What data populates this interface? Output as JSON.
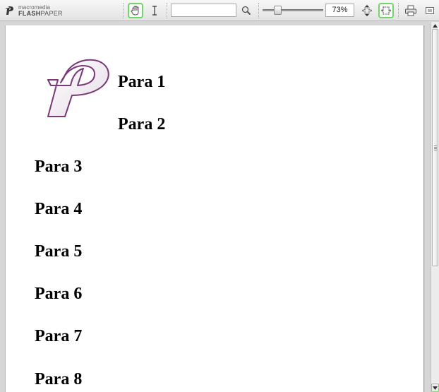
{
  "toolbar": {
    "logo_top": "macromedia",
    "logo_bold": "FLASH",
    "logo_rest": "PAPER",
    "tools": [
      "hand-tool-icon",
      "text-select-icon",
      "search-icon",
      "fit-height-icon",
      "fit-width-icon",
      "print-icon",
      "options-menu-icon"
    ],
    "search": {
      "value": "",
      "placeholder": ""
    },
    "zoom": {
      "value": "73%",
      "slider_fraction": 0.22
    },
    "active_color": "#74d36a"
  },
  "document": {
    "paragraphs": [
      "Para 1",
      "Para 2",
      "Para 3",
      "Para 4",
      "Para 5",
      "Para 6",
      "Para 7",
      "Para 8"
    ],
    "logo_color": "#7a3a78"
  },
  "scrollbar": {
    "position_fraction": 0.0
  }
}
